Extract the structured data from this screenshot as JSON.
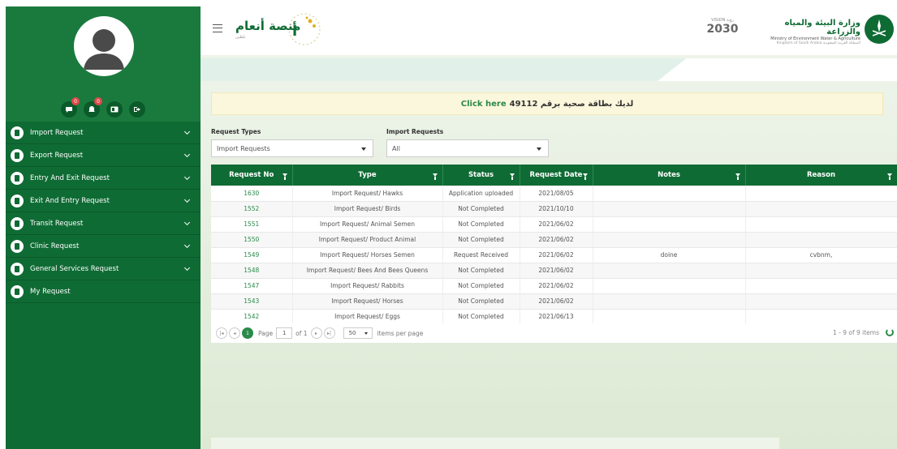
{
  "sidebar": {
    "icons": [
      {
        "name": "messages-icon",
        "badge": "0"
      },
      {
        "name": "notifications-icon",
        "badge": "0"
      },
      {
        "name": "id-card-icon",
        "badge": ""
      },
      {
        "name": "logout-icon",
        "badge": ""
      }
    ],
    "items": [
      {
        "label": "Import Request",
        "has_children": true
      },
      {
        "label": "Export Request",
        "has_children": true
      },
      {
        "label": "Entry And Exit Request",
        "has_children": true
      },
      {
        "label": "Exit And Entry Request",
        "has_children": true
      },
      {
        "label": "Transit Request",
        "has_children": true
      },
      {
        "label": "Clinic Request",
        "has_children": true
      },
      {
        "label": "General Services Request",
        "has_children": true
      },
      {
        "label": "My Request",
        "has_children": false
      }
    ]
  },
  "header": {
    "logo_text": "منصة أنعام",
    "logo_sub": "بلطين",
    "vision_small": "VISION رؤية",
    "vision_year": "2030",
    "ministry_ar": "وزارة البيئة والمياه والزراعة",
    "ministry_en": "Ministry of Environment Water & Agriculture",
    "ministry_en2": "Kingdom of Saudi Arabia  المملكة العربية السعودية"
  },
  "banner": {
    "text_ar": "لديك بطاقة صحية برقم 49112",
    "link": "Click here"
  },
  "filters": {
    "request_types_label": "Request Types",
    "request_types_value": "Import Requests",
    "import_requests_label": "Import Requests",
    "import_requests_value": "All"
  },
  "table": {
    "columns": [
      "Request No",
      "Type",
      "Status",
      "Request Date",
      "Notes",
      "Reason"
    ],
    "rows": [
      [
        "1630",
        "Import Request/ Hawks",
        "Application uploaded",
        "2021/08/05",
        "",
        ""
      ],
      [
        "1552",
        "Import Request/ Birds",
        "Not Completed",
        "2021/10/10",
        "",
        ""
      ],
      [
        "1551",
        "Import Request/ Animal Semen",
        "Not Completed",
        "2021/06/02",
        "",
        ""
      ],
      [
        "1550",
        "Import Request/ Product Animal",
        "Not Completed",
        "2021/06/02",
        "",
        ""
      ],
      [
        "1549",
        "Import Request/ Horses Semen",
        "Request Received",
        "2021/06/02",
        "doine",
        "cvbnm,"
      ],
      [
        "1548",
        "Import Request/ Bees And Bees Queens",
        "Not Completed",
        "2021/06/02",
        "",
        ""
      ],
      [
        "1547",
        "Import Request/ Rabbits",
        "Not Completed",
        "2021/06/02",
        "",
        ""
      ],
      [
        "1543",
        "Import Request/ Horses",
        "Not Completed",
        "2021/06/02",
        "",
        ""
      ],
      [
        "1542",
        "Import Request/ Eggs",
        "Not Completed",
        "2021/06/13",
        "",
        ""
      ]
    ]
  },
  "pager": {
    "current_page": "1",
    "page_label": "Page",
    "page_value": "1",
    "of_label": "of 1",
    "page_size": "50",
    "per_page_label": "items per page",
    "info": "1 - 9 of 9 items"
  },
  "colors": {
    "primary_green": "#0f6b34",
    "link_green": "#2a8a4a",
    "banner_yellow": "#fbf7dc"
  }
}
